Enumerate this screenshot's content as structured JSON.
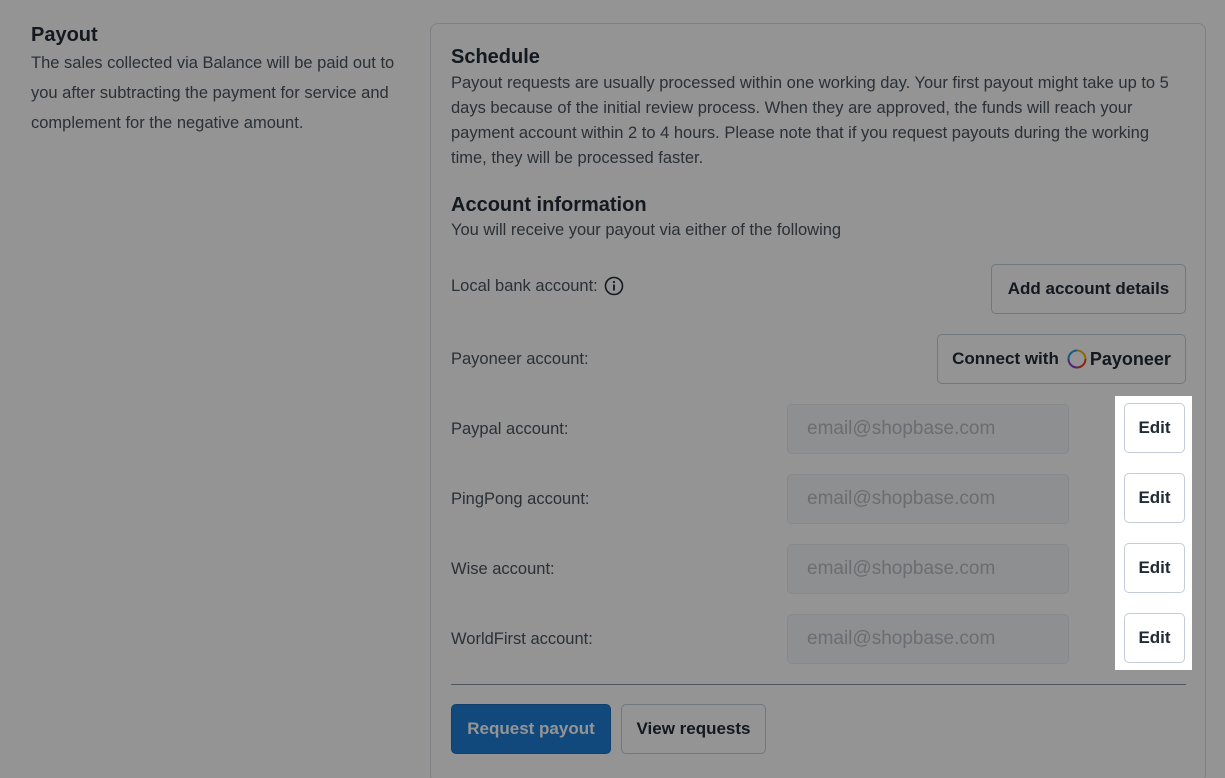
{
  "payout": {
    "title": "Payout",
    "description": "The sales collected via Balance will be paid out to you after subtracting the payment for service and complement for the negative amount."
  },
  "schedule": {
    "title": "Schedule",
    "text": "Payout requests are usually processed within one working day. Your first payout might take up to 5 days because of the initial review process. When they are approved, the funds will reach your payment account within 2 to 4 hours. Please note that if you request payouts during the working time, they will be processed faster."
  },
  "account_info": {
    "title": "Account information",
    "subtitle": "You will receive your payout via either of the following"
  },
  "local_bank": {
    "label": "Local bank account:",
    "button": "Add account details",
    "icon": "info-icon"
  },
  "payoneer": {
    "label": "Payoneer account:",
    "button_prefix": "Connect with",
    "brand": "Payoneer",
    "icon": "payoneer-logo-icon"
  },
  "accounts": [
    {
      "label": "Paypal account:",
      "placeholder": "email@shopbase.com",
      "edit": "Edit"
    },
    {
      "label": "PingPong account:",
      "placeholder": "email@shopbase.com",
      "edit": "Edit"
    },
    {
      "label": "Wise account:",
      "placeholder": "email@shopbase.com",
      "edit": "Edit"
    },
    {
      "label": "WorldFirst account:",
      "placeholder": "email@shopbase.com",
      "edit": "Edit"
    }
  ],
  "actions": {
    "request_payout": "Request payout",
    "view_requests": "View requests"
  },
  "colors": {
    "primary": "#1f7fd6",
    "overlay": "rgba(0,0,0,0.42)"
  }
}
